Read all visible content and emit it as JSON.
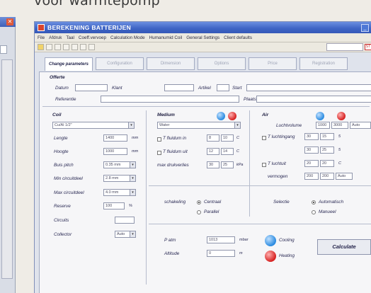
{
  "caption": "voor warmtepomp",
  "window": {
    "title": "BEREKENING BATTERIJEN",
    "minimize_glyph": "_"
  },
  "menu": [
    "File",
    "Afdruk",
    "Taal",
    "Coeff.vervoep",
    "Calculation Mode",
    "Humanumid Coil",
    "General Settings",
    "Client defaults"
  ],
  "toolbar": {
    "red_badge": "ST"
  },
  "tabs": [
    {
      "label": "Change parameters",
      "active": true
    },
    {
      "label": "Configuration",
      "active": false
    },
    {
      "label": "Dimension",
      "active": false
    },
    {
      "label": "Options",
      "active": false
    },
    {
      "label": "Price",
      "active": false
    },
    {
      "label": "Registration",
      "active": false
    }
  ],
  "offerte": {
    "header": "Offerte",
    "labels": {
      "datum": "Datum",
      "klant": "Klant",
      "artikel": "Artikel",
      "start": "Start",
      "referentie": "Referentie",
      "plaats": "Plaats"
    }
  },
  "coil": {
    "header": "Coil",
    "type_value": "Cu/Al 1/2\"",
    "rows": [
      {
        "label": "Lengte",
        "value": "1400",
        "unit": "mm"
      },
      {
        "label": "Hoogte",
        "value": "1000",
        "unit": "mm"
      },
      {
        "label": "Buis pitch",
        "value": "0.35 mm"
      },
      {
        "label": "Min circuitdeel",
        "value": "2.8 mm"
      },
      {
        "label": "Max circuitdeel",
        "value": "4.0 mm"
      },
      {
        "label": "Reserve",
        "value": "100",
        "unit": "%"
      },
      {
        "label": "Circuits",
        "value": ""
      },
      {
        "label": "Collector",
        "value": "Auto"
      }
    ]
  },
  "medium": {
    "header": "Medium",
    "type_value": "Water",
    "rows": [
      {
        "label": "T fluidum in",
        "v1": "8",
        "v2": "10",
        "unit": "C"
      },
      {
        "label": "T fluidum uit",
        "v1": "12",
        "v2": "14",
        "unit": "C"
      },
      {
        "label": "max drukverlies",
        "v1": "30",
        "v2": "25",
        "unit": "kPa"
      }
    ]
  },
  "air": {
    "header": "Air",
    "rows": [
      {
        "label": "Luchtvolume",
        "v1": "1000",
        "v2": "3000",
        "v3": "Auto"
      },
      {
        "label": "T luchtingang",
        "v1": "30",
        "v2": "15",
        "v3": "5"
      },
      {
        "label": "",
        "v1": "30",
        "v2": "25",
        "v3": "5"
      },
      {
        "label": "T luchtuit",
        "v1": "20",
        "v2": "20",
        "v3": "C"
      },
      {
        "label": "vermogen",
        "v1": "200",
        "v2": "200",
        "v3": "Auto"
      }
    ]
  },
  "schakeling": {
    "label": "schakeling",
    "opt1": "Centraal",
    "opt2": "Parallel"
  },
  "selectie": {
    "label": "Selectie",
    "opt1": "Automatisch",
    "opt2": "Manueel"
  },
  "bottom": {
    "p_atm_label": "P atm",
    "p_atm_value": "1013",
    "p_atm_unit": "mbar",
    "altitude_label": "Altitude",
    "altitude_value": "0",
    "altitude_unit": "m",
    "cooling": "Cooling",
    "heating": "Heating",
    "calculate": "Calculate"
  }
}
